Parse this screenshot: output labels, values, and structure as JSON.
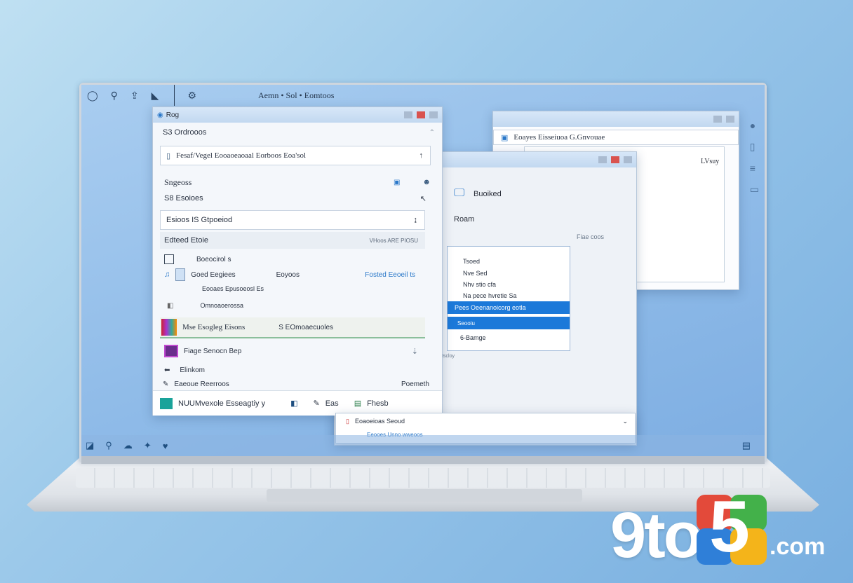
{
  "desktop": {
    "topbar_title": "Aemn • Sol • Eomtoos"
  },
  "main_window": {
    "title": "Rog",
    "subtitle": "S3 Ordrooos",
    "address": "Fesaf/Vegel Eooaoeaoaal Eorboos Eoa'sol",
    "section_title": "Sngeoss",
    "section_sub": "S8  Esoioes",
    "field2": "Esioos IS Gtpoeiod",
    "list_header": "Edteed Etoie",
    "list_header_right": "VHoos ARE PIOSU",
    "items": [
      {
        "label": "Boeocirol s"
      },
      {
        "label": "Goed Eegiees",
        "mid": "Eoyoos",
        "right": "Fosted Eeoeil ts"
      },
      {
        "label": "Eooaes Epusoeosl Es"
      },
      {
        "label": "Omnoaoerossa"
      }
    ],
    "highlight_label": "Mse Esogleg Eisons",
    "highlight_right": "S  EOmoaecuoles",
    "item_after": "Fiage Senocn Bep",
    "item_after2": "Elinkom",
    "footer_left": "Eaeoue Reerroos",
    "footer_right": "Poemeth",
    "bottom_label": "NUUMvexole Esseagtiy y",
    "bottom_btn1": "Eas",
    "bottom_btn2": "Fhesb"
  },
  "back_window": {
    "label1": "Buoiked",
    "label2": "Roam",
    "menu": [
      "Tsoed",
      "Nve Sed",
      "Nhv stio cfa",
      "Na pece hvretie Sa"
    ],
    "menu_selected": "Pees Oeenanoicorg eotla",
    "menu_selected2": "Seooiu",
    "menu_footer": "6-Bamge",
    "side_text": "Fiae coos",
    "tiny_label": "Nscloy"
  },
  "right_window": {
    "address": "Eoayes Eisseiuoa G.Gnvouae",
    "label": "LVsuy"
  },
  "popup": {
    "title": "Eoaoeioas Seoud",
    "link": "Eeooes Unno wweoos"
  },
  "watermark": {
    "brand_9to": "9to",
    "brand_5": "5",
    "brand_com": ".com"
  }
}
